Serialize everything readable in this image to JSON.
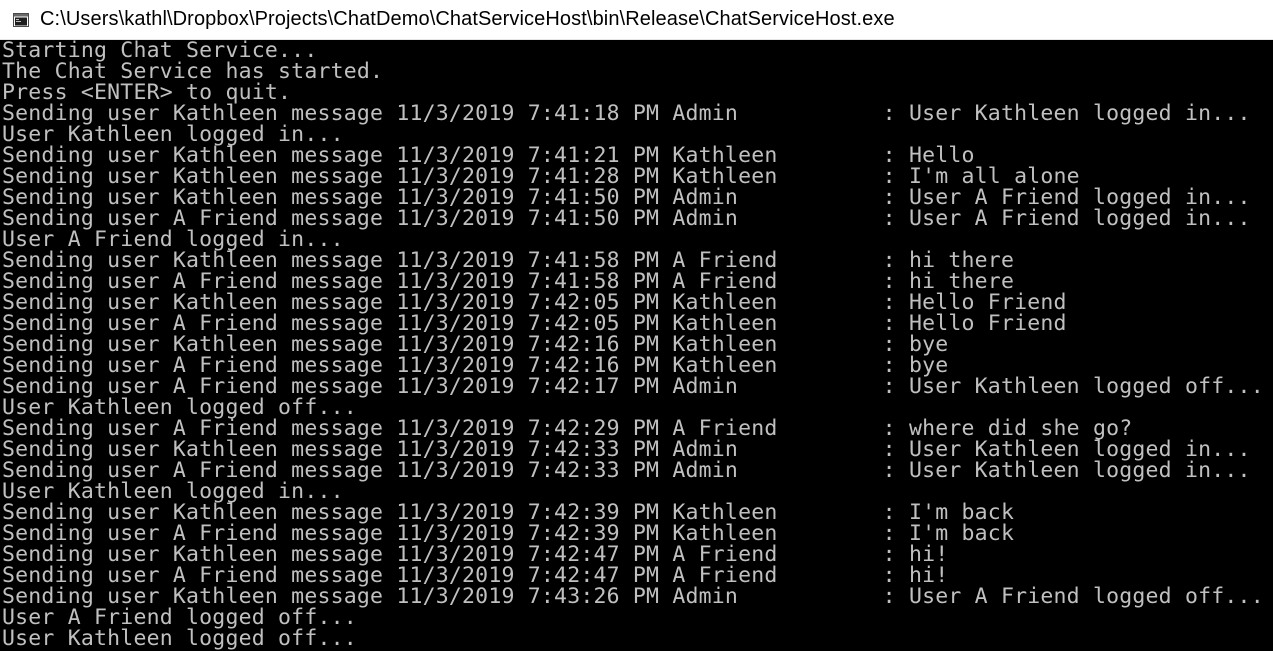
{
  "window": {
    "title": "C:\\Users\\kathl\\Dropbox\\Projects\\ChatDemo\\ChatServiceHost\\bin\\Release\\ChatServiceHost.exe",
    "icon": "console-app-icon"
  },
  "colors": {
    "console_background": "#000000",
    "console_text": "#c0c0c0",
    "titlebar_background": "#ffffff"
  },
  "console": {
    "lines": [
      "Starting Chat Service...",
      "The Chat Service has started.",
      "Press <ENTER> to quit.",
      "Sending user Kathleen message 11/3/2019 7:41:18 PM Admin           : User Kathleen logged in...",
      "User Kathleen logged in...",
      "Sending user Kathleen message 11/3/2019 7:41:21 PM Kathleen        : Hello",
      "Sending user Kathleen message 11/3/2019 7:41:28 PM Kathleen        : I'm all alone",
      "Sending user Kathleen message 11/3/2019 7:41:50 PM Admin           : User A Friend logged in...",
      "Sending user A Friend message 11/3/2019 7:41:50 PM Admin           : User A Friend logged in...",
      "User A Friend logged in...",
      "Sending user Kathleen message 11/3/2019 7:41:58 PM A Friend        : hi there",
      "Sending user A Friend message 11/3/2019 7:41:58 PM A Friend        : hi there",
      "Sending user Kathleen message 11/3/2019 7:42:05 PM Kathleen        : Hello Friend",
      "Sending user A Friend message 11/3/2019 7:42:05 PM Kathleen        : Hello Friend",
      "Sending user Kathleen message 11/3/2019 7:42:16 PM Kathleen        : bye",
      "Sending user A Friend message 11/3/2019 7:42:16 PM Kathleen        : bye",
      "Sending user A Friend message 11/3/2019 7:42:17 PM Admin           : User Kathleen logged off...",
      "User Kathleen logged off...",
      "Sending user A Friend message 11/3/2019 7:42:29 PM A Friend        : where did she go?",
      "Sending user Kathleen message 11/3/2019 7:42:33 PM Admin           : User Kathleen logged in...",
      "Sending user A Friend message 11/3/2019 7:42:33 PM Admin           : User Kathleen logged in...",
      "User Kathleen logged in...",
      "Sending user Kathleen message 11/3/2019 7:42:39 PM Kathleen        : I'm back",
      "Sending user A Friend message 11/3/2019 7:42:39 PM Kathleen        : I'm back",
      "Sending user Kathleen message 11/3/2019 7:42:47 PM A Friend        : hi!",
      "Sending user A Friend message 11/3/2019 7:42:47 PM A Friend        : hi!",
      "Sending user Kathleen message 11/3/2019 7:43:26 PM Admin           : User A Friend logged off...",
      "User A Friend logged off...",
      "User Kathleen logged off..."
    ]
  }
}
